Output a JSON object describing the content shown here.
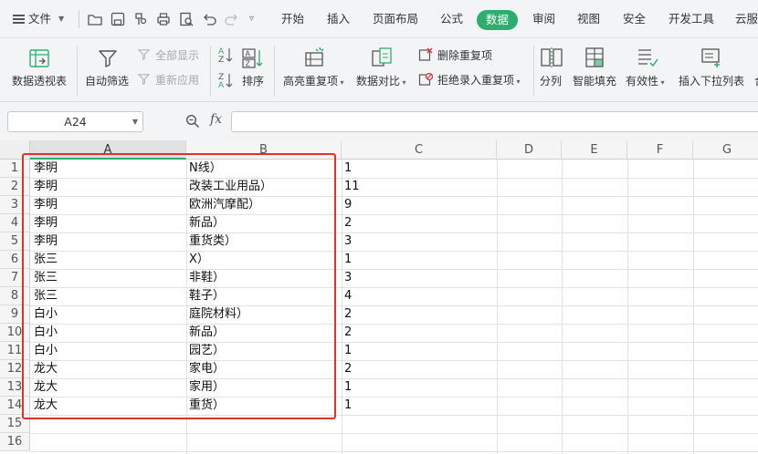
{
  "menubar": {
    "file_label": "文件",
    "tabs": [
      {
        "label": "开始"
      },
      {
        "label": "插入"
      },
      {
        "label": "页面布局"
      },
      {
        "label": "公式"
      },
      {
        "label": "数据"
      },
      {
        "label": "审阅"
      },
      {
        "label": "视图"
      },
      {
        "label": "安全"
      },
      {
        "label": "开发工具"
      },
      {
        "label": "云服"
      }
    ],
    "active_tab": "数据",
    "accent_color": "#2eae6e"
  },
  "ribbon": {
    "pivot_table": "数据透视表",
    "auto_filter": "自动筛选",
    "show_all": "全部显示",
    "reapply": "重新应用",
    "sort": "排序",
    "highlight_duplicates": "高亮重复项",
    "data_compare": "数据对比",
    "remove_duplicates": "删除重复项",
    "reject_duplicates": "拒绝录入重复项",
    "split_column": "分列",
    "smart_fill": "智能填充",
    "validation": "有效性",
    "insert_dropdown": "插入下拉列表"
  },
  "formula_bar": {
    "cell_ref": "A24",
    "fx_label": "fx",
    "formula": ""
  },
  "sheet": {
    "columns": [
      "A",
      "B",
      "C",
      "D",
      "E",
      "F",
      "G"
    ],
    "selected_column": "A",
    "row_numbers": [
      "1",
      "2",
      "3",
      "4",
      "5",
      "6",
      "7",
      "8",
      "9",
      "10",
      "11",
      "12",
      "13",
      "14",
      "15",
      "16"
    ],
    "rows": [
      {
        "a": "李明",
        "b": "N线）",
        "c": "1"
      },
      {
        "a": "李明",
        "b": "改装工业用品）",
        "c": "11"
      },
      {
        "a": "李明",
        "b": "欧洲汽摩配）",
        "c": "9"
      },
      {
        "a": "李明",
        "b": "新品）",
        "c": "2"
      },
      {
        "a": "李明",
        "b": "重货类）",
        "c": "3"
      },
      {
        "a": "张三",
        "b": "X）",
        "c": "1"
      },
      {
        "a": "张三",
        "b": "非鞋）",
        "c": "3"
      },
      {
        "a": "张三",
        "b": "鞋子）",
        "c": "4"
      },
      {
        "a": "白小",
        "b": "庭院材料）",
        "c": "2"
      },
      {
        "a": "白小",
        "b": "新品）",
        "c": "2"
      },
      {
        "a": "白小",
        "b": "园艺）",
        "c": "1"
      },
      {
        "a": "龙大",
        "b": "家电）",
        "c": "2"
      },
      {
        "a": "龙大",
        "b": "家用）",
        "c": "1"
      },
      {
        "a": "龙大",
        "b": "重货）",
        "c": "1"
      }
    ],
    "highlight_color": "#e0322c"
  }
}
